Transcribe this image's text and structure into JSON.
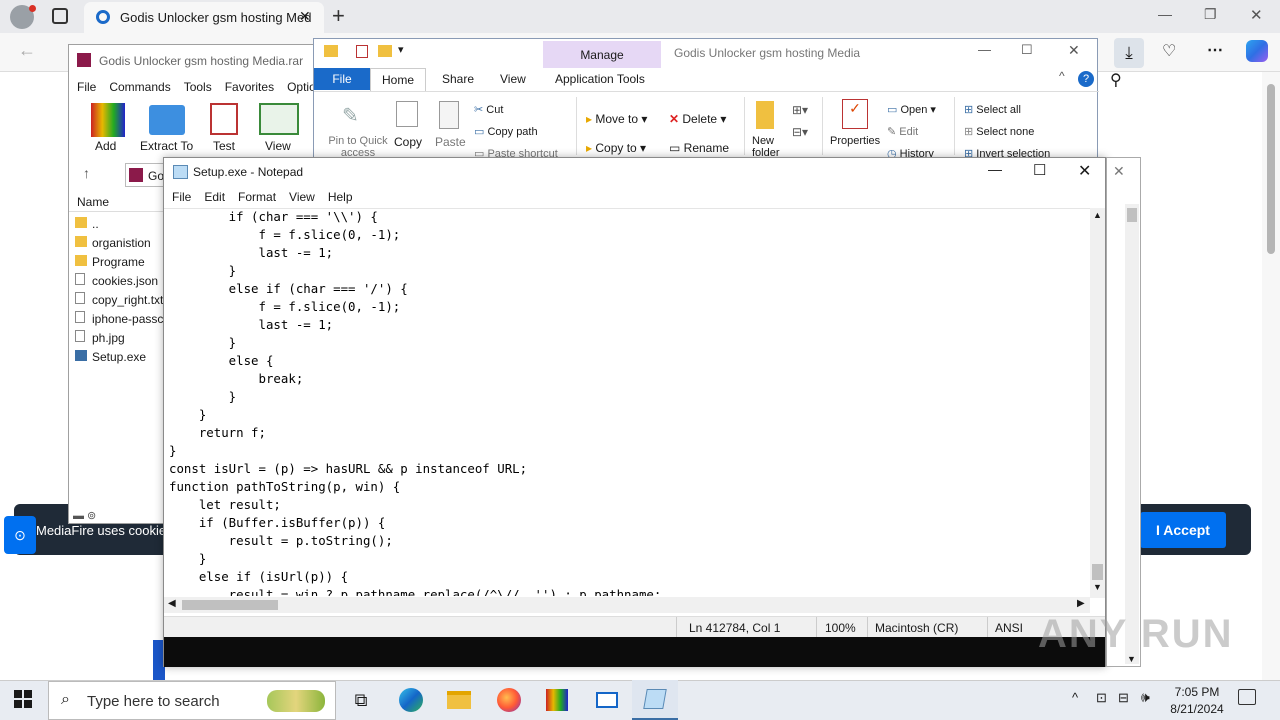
{
  "browser": {
    "tab_title": "Godis Unlocker gsm hosting Med",
    "new_tab": "+",
    "window_min": "—",
    "window_max": "❐",
    "window_close": "✕"
  },
  "mediafire": {
    "cookie_text": "MediaFire uses cookies",
    "accept": "I Accept"
  },
  "winrar": {
    "title": "Godis Unlocker gsm hosting Media.rar",
    "menu": [
      "File",
      "Commands",
      "Tools",
      "Favorites",
      "Optio"
    ],
    "tools": [
      "Add",
      "Extract To",
      "Test",
      "View"
    ],
    "path_prefix": "Go",
    "column_name": "Name",
    "files": [
      "..",
      "organistion",
      "Programe",
      "cookies.json",
      "copy_right.txt",
      "iphone-passc",
      "ph.jpg",
      "Setup.exe"
    ]
  },
  "explorer": {
    "title": "Godis Unlocker gsm hosting Media",
    "manage": "Manage",
    "tabs": [
      "File",
      "Home",
      "Share",
      "View",
      "Application Tools"
    ],
    "pin": "Pin to Quick access",
    "copy": "Copy",
    "paste": "Paste",
    "cut": "Cut",
    "copy_path": "Copy path",
    "paste_shortcut": "Paste shortcut",
    "move_to": "Move to",
    "copy_to": "Copy to",
    "delete": "Delete",
    "rename": "Rename",
    "new_folder": "New folder",
    "properties": "Properties",
    "open": "Open",
    "edit": "Edit",
    "history": "History",
    "select_all": "Select all",
    "select_none": "Select none",
    "invert_selection": "Invert selection"
  },
  "notepad": {
    "title": "Setup.exe - Notepad",
    "menu": [
      "File",
      "Edit",
      "Format",
      "View",
      "Help"
    ],
    "code": "        if (char === '\\\\') {\n            f = f.slice(0, -1);\n            last -= 1;\n        }\n        else if (char === '/') {\n            f = f.slice(0, -1);\n            last -= 1;\n        }\n        else {\n            break;\n        }\n    }\n    return f;\n}\nconst isUrl = (p) => hasURL && p instanceof URL;\nfunction pathToString(p, win) {\n    let result;\n    if (Buffer.isBuffer(p)) {\n        result = p.toString();\n    }\n    else if (isUrl(p)) {\n        result = win ? p.pathname.replace(/^\\//, '') : p.pathname;",
    "status": {
      "position": "Ln 412784, Col 1",
      "zoom": "100%",
      "eol": "Macintosh (CR)",
      "encoding": "ANSI"
    }
  },
  "taskbar": {
    "search_placeholder": "Type here to search",
    "time": "7:05 PM",
    "date": "8/21/2024"
  },
  "watermark": "ANY RUN"
}
